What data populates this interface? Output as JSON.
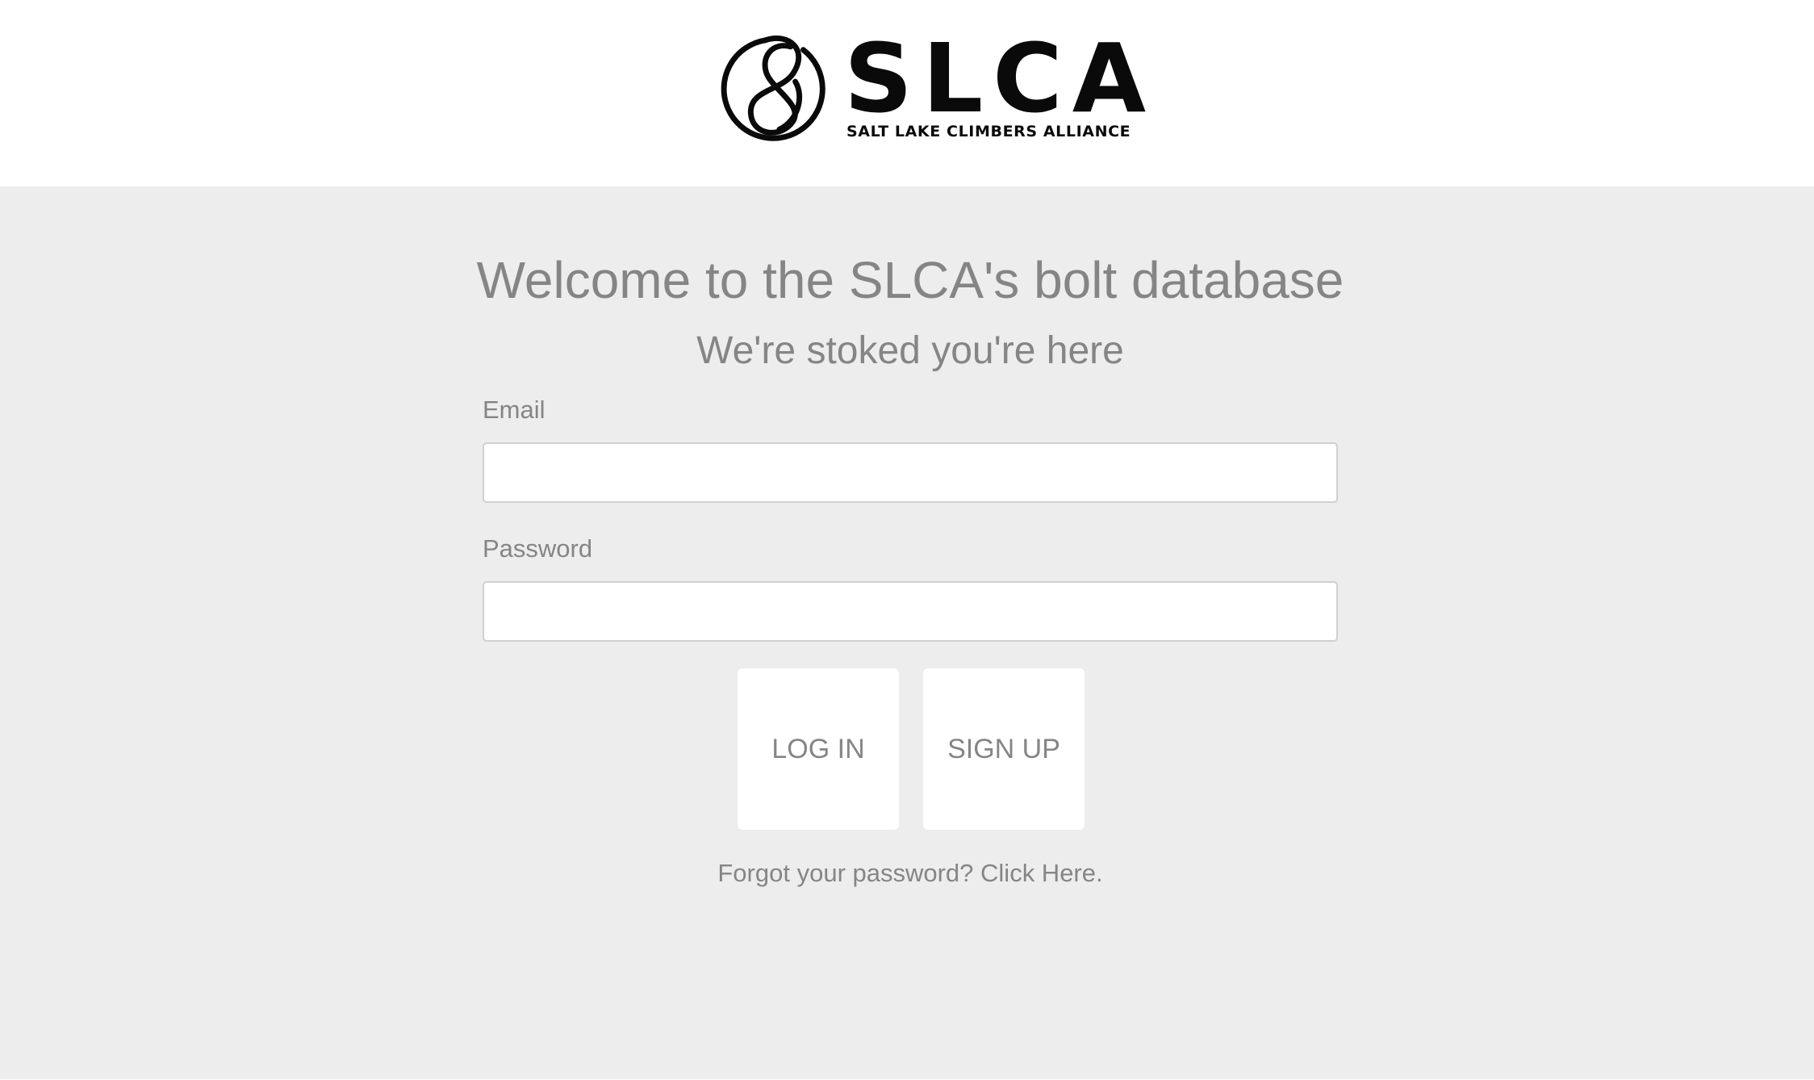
{
  "header": {
    "logo": {
      "wordmark": "SLCA",
      "tagline": "SALT LAKE CLIMBERS ALLIANCE",
      "icon": "rope-knot-icon"
    }
  },
  "main": {
    "title": "Welcome to the SLCA's bolt database",
    "subtitle": "We're stoked you're here",
    "form": {
      "email_label": "Email",
      "email_value": "",
      "password_label": "Password",
      "password_value": ""
    },
    "buttons": {
      "login_label": "LOG IN",
      "signup_label": "SIGN UP"
    },
    "forgot_password_text": "Forgot your password? Click Here."
  },
  "colors": {
    "background": "#ededed",
    "header_background": "#ffffff",
    "text": "#858585",
    "logo": "#0a0a0a"
  }
}
